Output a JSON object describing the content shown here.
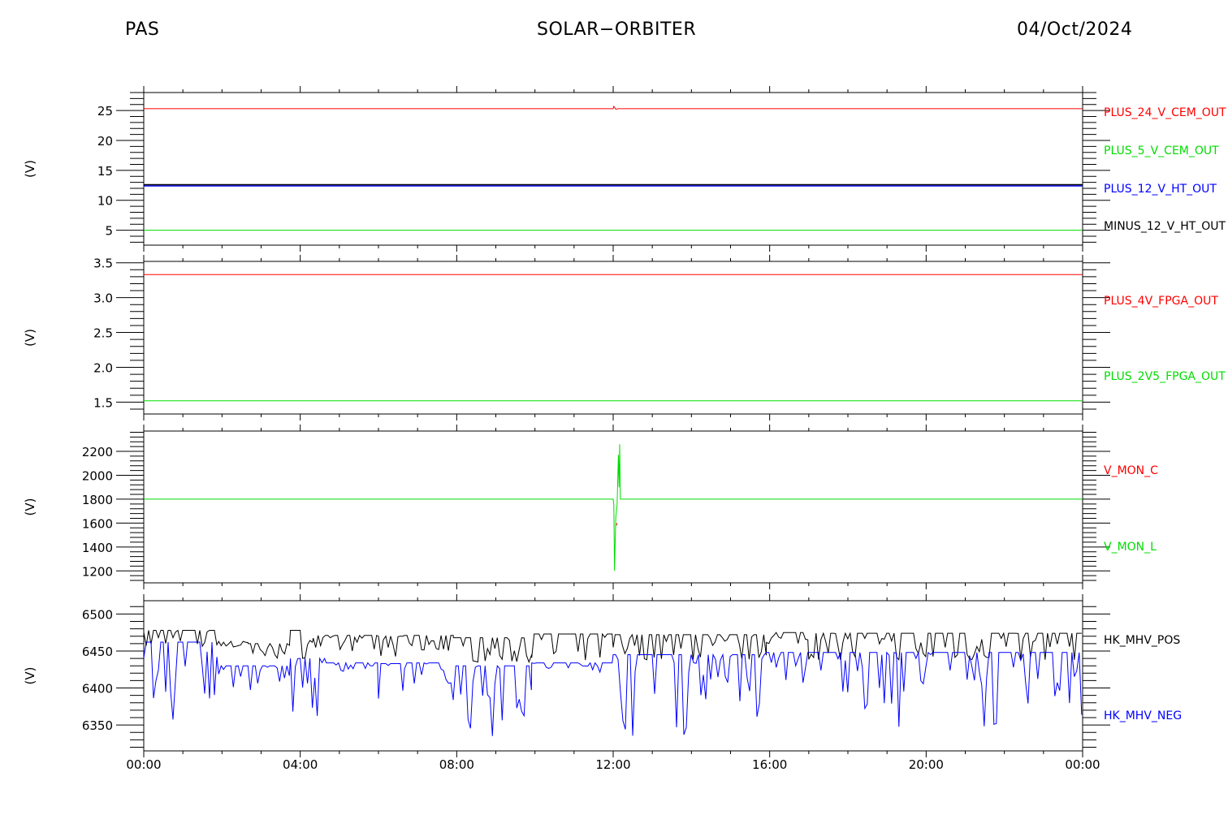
{
  "header": {
    "left": "PAS",
    "center": "SOLAR−ORBITER",
    "right": "04/Oct/2024"
  },
  "chart_data": [
    {
      "type": "line",
      "ylabel": "(V)",
      "ylim": [
        2.5,
        28
      ],
      "yticks": [
        {
          "v": 5,
          "label": "5"
        },
        {
          "v": 10,
          "label": "10"
        },
        {
          "v": 15,
          "label": "15"
        },
        {
          "v": 20,
          "label": "20"
        },
        {
          "v": 25,
          "label": "25"
        }
      ],
      "series": [
        {
          "name": "PLUS_24_V_CEM_OUT",
          "color": "#ff0000",
          "points": [
            [
              "00:00",
              25.3
            ],
            [
              "12:00",
              25.3
            ],
            [
              "12:01",
              25.7
            ],
            [
              "12:04",
              25.2
            ],
            [
              "12:08",
              25.3
            ],
            [
              "24:00",
              25.3
            ]
          ]
        },
        {
          "name": "PLUS_5_V_CEM_OUT",
          "color": "#00dd00",
          "points": [
            [
              "00:00",
              5.0
            ],
            [
              "24:00",
              5.0
            ]
          ]
        },
        {
          "name": "PLUS_12_V_HT_OUT",
          "color": "#0000ff",
          "points": [
            [
              "00:00",
              12.4
            ],
            [
              "24:00",
              12.4
            ]
          ]
        },
        {
          "name": "MINUS_12_V_HT_OUT",
          "color": "#000000",
          "points": [
            [
              "00:00",
              12.6
            ],
            [
              "24:00",
              12.6
            ]
          ]
        }
      ]
    },
    {
      "type": "line",
      "ylabel": "(V)",
      "ylim": [
        1.33,
        3.52
      ],
      "yticks": [
        {
          "v": 1.5,
          "label": "1.5"
        },
        {
          "v": 2.0,
          "label": "2.0"
        },
        {
          "v": 2.5,
          "label": "2.5"
        },
        {
          "v": 3.0,
          "label": "3.0"
        },
        {
          "v": 3.5,
          "label": "3.5"
        }
      ],
      "series": [
        {
          "name": "PLUS_4V_FPGA_OUT",
          "color": "#ff0000",
          "points": [
            [
              "00:00",
              3.33
            ],
            [
              "24:00",
              3.33
            ]
          ]
        },
        {
          "name": "PLUS_2V5_FPGA_OUT",
          "color": "#00dd00",
          "points": [
            [
              "00:00",
              1.52
            ],
            [
              "24:00",
              1.52
            ]
          ]
        }
      ]
    },
    {
      "type": "line",
      "ylabel": "(V)",
      "ylim": [
        1100,
        2370
      ],
      "yticks": [
        {
          "v": 1200,
          "label": "1200"
        },
        {
          "v": 1400,
          "label": "1400"
        },
        {
          "v": 1600,
          "label": "1600"
        },
        {
          "v": 1800,
          "label": "1800"
        },
        {
          "v": 2000,
          "label": "2000"
        },
        {
          "v": 2200,
          "label": "2200"
        }
      ],
      "series": [
        {
          "name": "V_MON_C",
          "color": "#ff0000",
          "points": [
            [
              "12:05",
              1580
            ],
            [
              "12:06",
              1600
            ]
          ]
        },
        {
          "name": "V_MON_L",
          "color": "#00dd00",
          "points": [
            [
              "00:00",
              1800
            ],
            [
              "12:00",
              1800
            ],
            [
              "12:01",
              1750
            ],
            [
              "12:02",
              1200
            ],
            [
              "12:04",
              1650
            ],
            [
              "12:06",
              1750
            ],
            [
              "12:08",
              2170
            ],
            [
              "12:09",
              1900
            ],
            [
              "12:10",
              2260
            ],
            [
              "12:11",
              1800
            ],
            [
              "24:00",
              1800
            ]
          ]
        }
      ]
    },
    {
      "type": "line",
      "ylabel": "(V)",
      "ylim": [
        6315,
        6518
      ],
      "yticks": [
        {
          "v": 6350,
          "label": "6350"
        },
        {
          "v": 6400,
          "label": "6400"
        },
        {
          "v": 6450,
          "label": "6450"
        },
        {
          "v": 6500,
          "label": "6500"
        }
      ],
      "series": [
        {
          "name": "HK_MHV_POS",
          "color": "#000000",
          "segments": [
            {
              "from": "00:00",
              "to": "01:55",
              "base": 6478,
              "low": 6455
            },
            {
              "from": "01:55",
              "to": "02:40",
              "base": 6463,
              "low": 6455
            },
            {
              "from": "02:40",
              "to": "03:45",
              "base": 6460,
              "low": 6440
            },
            {
              "from": "03:45",
              "to": "04:20",
              "base": 6478,
              "low": 6440
            },
            {
              "from": "04:20",
              "to": "06:00",
              "base": 6471,
              "low": 6450
            },
            {
              "from": "06:00",
              "to": "06:40",
              "base": 6470,
              "low": 6440
            },
            {
              "from": "06:40",
              "to": "07:55",
              "base": 6471,
              "low": 6450
            },
            {
              "from": "07:55",
              "to": "09:55",
              "base": 6468,
              "low": 6435
            },
            {
              "from": "09:55",
              "to": "12:00",
              "base": 6473,
              "low": 6437
            },
            {
              "from": "12:00",
              "to": "12:03",
              "base": 6498,
              "low": 6437
            },
            {
              "from": "12:03",
              "to": "15:55",
              "base": 6472,
              "low": 6438
            },
            {
              "from": "15:55",
              "to": "17:00",
              "base": 6475,
              "low": 6460
            },
            {
              "from": "17:00",
              "to": "24:00",
              "base": 6474,
              "low": 6438
            }
          ]
        },
        {
          "name": "HK_MHV_NEG",
          "color": "#0000ff",
          "segments": [
            {
              "from": "00:00",
              "to": "01:55",
              "base": 6462,
              "low": 6330
            },
            {
              "from": "01:55",
              "to": "03:45",
              "base": 6430,
              "low": 6385
            },
            {
              "from": "03:45",
              "to": "04:40",
              "base": 6440,
              "low": 6330
            },
            {
              "from": "04:40",
              "to": "06:00",
              "base": 6434,
              "low": 6420
            },
            {
              "from": "06:00",
              "to": "06:40",
              "base": 6433,
              "low": 6330
            },
            {
              "from": "06:40",
              "to": "07:55",
              "base": 6434,
              "low": 6380
            },
            {
              "from": "07:55",
              "to": "09:55",
              "base": 6430,
              "low": 6330
            },
            {
              "from": "09:55",
              "to": "12:00",
              "base": 6434,
              "low": 6420
            },
            {
              "from": "12:00",
              "to": "15:55",
              "base": 6445,
              "low": 6330
            },
            {
              "from": "15:55",
              "to": "17:00",
              "base": 6448,
              "low": 6395
            },
            {
              "from": "17:00",
              "to": "24:00",
              "base": 6448,
              "low": 6330
            }
          ]
        }
      ]
    }
  ],
  "xaxis": {
    "ticks": [
      "00:00",
      "04:00",
      "08:00",
      "12:00",
      "16:00",
      "20:00",
      "00:00"
    ],
    "range_hours": [
      0,
      24
    ]
  }
}
